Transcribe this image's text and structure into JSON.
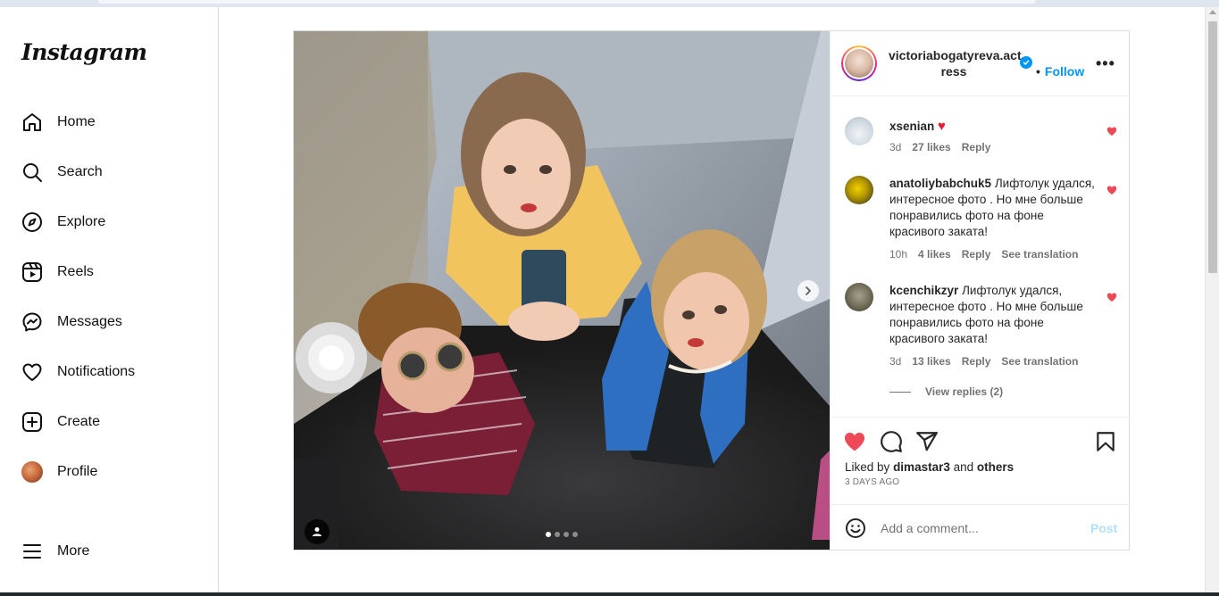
{
  "brand": {
    "logo_text": "Instagram"
  },
  "sidebar": {
    "items": [
      {
        "label": "Home",
        "icon": "home-icon"
      },
      {
        "label": "Search",
        "icon": "search-icon"
      },
      {
        "label": "Explore",
        "icon": "compass-icon"
      },
      {
        "label": "Reels",
        "icon": "reels-icon"
      },
      {
        "label": "Messages",
        "icon": "messenger-icon"
      },
      {
        "label": "Notifications",
        "icon": "heart-icon"
      },
      {
        "label": "Create",
        "icon": "plus-square-icon"
      },
      {
        "label": "Profile",
        "icon": "profile-avatar"
      }
    ],
    "more_label": "More"
  },
  "post": {
    "author": "victoriabogatyreva.actress",
    "author_line1": "victoriabogatyreva.act",
    "author_line2": "ress",
    "verified": true,
    "follow_label": "Follow",
    "follow_bullet": "•",
    "more_label": "•••",
    "carousel": {
      "count": 4,
      "active": 1
    },
    "comments": [
      {
        "user": "xsenian",
        "text": "",
        "emoji": "♥",
        "time": "3d",
        "likes": "27 likes",
        "reply": "Reply",
        "liked": true
      },
      {
        "user": "anatoliybabchuk5",
        "text": "Лифтолук удался, интересное фото . Но мне больше понравились фото на фоне красивого заката!",
        "time": "10h",
        "likes": "4 likes",
        "reply": "Reply",
        "translate": "See translation",
        "liked": true
      },
      {
        "user": "kcenchikzyr",
        "text": "Лифтолук удался, интересное фото . Но мне больше понравились фото на фоне красивого заката!",
        "time": "3d",
        "likes": "13 likes",
        "reply": "Reply",
        "translate": "See translation",
        "liked": true
      }
    ],
    "view_replies": "View replies (2)",
    "liked_by_prefix": "Liked by",
    "liked_by_user": "dimastar3",
    "liked_by_and": "and",
    "liked_by_others": "others",
    "date": "3 DAYS AGO",
    "comment_placeholder": "Add a comment...",
    "post_label": "Post"
  },
  "colors": {
    "like_red": "#ed4956",
    "link_blue": "#0095f6",
    "post_disabled": "#b2dffc"
  }
}
